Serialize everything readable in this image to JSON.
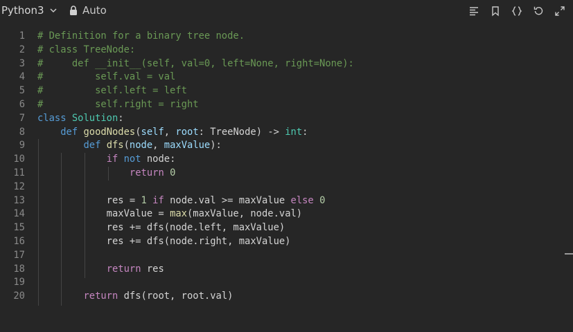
{
  "toolbar": {
    "language": "Python3",
    "mode": "Auto"
  },
  "icons": [
    "chevron-down-icon",
    "lock-icon",
    "format-icon",
    "bookmark-icon",
    "braces-icon",
    "reset-icon",
    "expand-icon"
  ],
  "editor": {
    "lines": [
      [
        {
          "t": "# Definition for a binary tree node.",
          "c": "c"
        }
      ],
      [
        {
          "t": "# class TreeNode:",
          "c": "c"
        }
      ],
      [
        {
          "t": "#     def __init__(self, val=0, left=None, right=None):",
          "c": "c"
        }
      ],
      [
        {
          "t": "#         self.val = val",
          "c": "c"
        }
      ],
      [
        {
          "t": "#         self.left = left",
          "c": "c"
        }
      ],
      [
        {
          "t": "#         self.right = right",
          "c": "c"
        }
      ],
      [
        {
          "t": "class ",
          "c": "k"
        },
        {
          "t": "Solution",
          "c": "t"
        },
        {
          "t": ":",
          "c": "p"
        }
      ],
      [
        {
          "t": "    ",
          "c": "p"
        },
        {
          "t": "def ",
          "c": "k"
        },
        {
          "t": "goodNodes",
          "c": "f"
        },
        {
          "t": "(",
          "c": "p"
        },
        {
          "t": "self",
          "c": "v"
        },
        {
          "t": ", ",
          "c": "p"
        },
        {
          "t": "root",
          "c": "v"
        },
        {
          "t": ": TreeNode) -> ",
          "c": "p"
        },
        {
          "t": "int",
          "c": "t"
        },
        {
          "t": ":",
          "c": "p"
        }
      ],
      [
        {
          "t": "        ",
          "c": "p"
        },
        {
          "t": "def ",
          "c": "k"
        },
        {
          "t": "dfs",
          "c": "f"
        },
        {
          "t": "(",
          "c": "p"
        },
        {
          "t": "node",
          "c": "v"
        },
        {
          "t": ", ",
          "c": "p"
        },
        {
          "t": "maxValue",
          "c": "v"
        },
        {
          "t": "):",
          "c": "p"
        }
      ],
      [
        {
          "t": "            ",
          "c": "p"
        },
        {
          "t": "if ",
          "c": "kc"
        },
        {
          "t": "not ",
          "c": "k"
        },
        {
          "t": "node:",
          "c": "p"
        }
      ],
      [
        {
          "t": "                ",
          "c": "p"
        },
        {
          "t": "return ",
          "c": "kc"
        },
        {
          "t": "0",
          "c": "n"
        }
      ],
      [],
      [
        {
          "t": "            res = ",
          "c": "p"
        },
        {
          "t": "1 ",
          "c": "n"
        },
        {
          "t": "if ",
          "c": "kc"
        },
        {
          "t": "node.val >= maxValue ",
          "c": "p"
        },
        {
          "t": "else ",
          "c": "kc"
        },
        {
          "t": "0",
          "c": "n"
        }
      ],
      [
        {
          "t": "            maxValue = ",
          "c": "p"
        },
        {
          "t": "max",
          "c": "f"
        },
        {
          "t": "(maxValue, node.val)",
          "c": "p"
        }
      ],
      [
        {
          "t": "            res += dfs(node.left, maxValue)",
          "c": "p"
        }
      ],
      [
        {
          "t": "            res += dfs(node.right, maxValue)",
          "c": "p"
        }
      ],
      [],
      [
        {
          "t": "            ",
          "c": "p"
        },
        {
          "t": "return ",
          "c": "kc"
        },
        {
          "t": "res",
          "c": "p"
        }
      ],
      [],
      [
        {
          "t": "        ",
          "c": "p"
        },
        {
          "t": "return ",
          "c": "kc"
        },
        {
          "t": "dfs(root, root.val)",
          "c": "p"
        }
      ]
    ]
  }
}
